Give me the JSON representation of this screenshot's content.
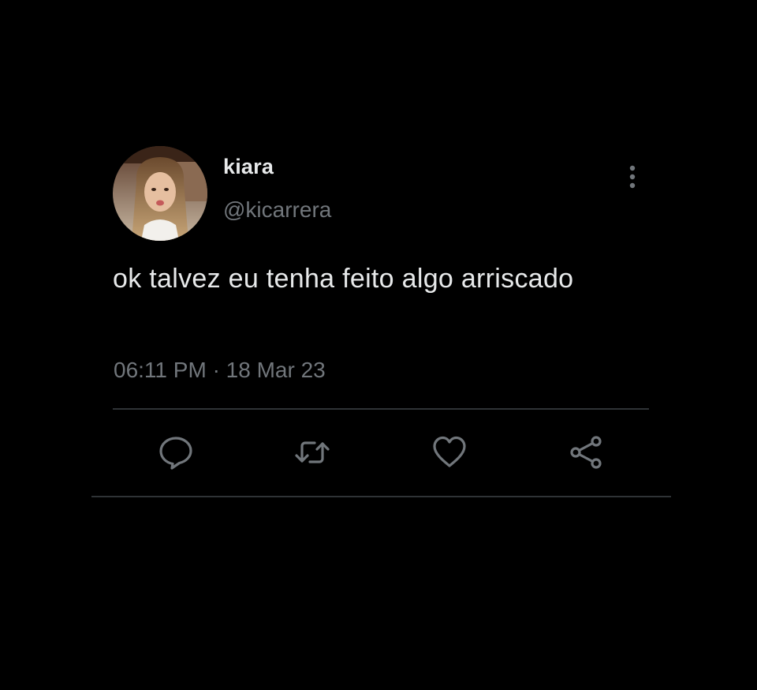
{
  "tweet": {
    "author": {
      "display_name": "kiara",
      "handle": "@kicarrera"
    },
    "text": "ok talvez eu tenha feito algo arriscado",
    "time": "06:11 PM",
    "separator": "·",
    "date": "18 Mar 23"
  },
  "actions": {
    "icons": [
      "reply-icon",
      "retweet-icon",
      "like-icon",
      "share-icon"
    ]
  },
  "colors": {
    "background": "#000000",
    "primary_text": "#e7e9ea",
    "secondary_text": "#71767b",
    "divider": "#2f3336"
  }
}
